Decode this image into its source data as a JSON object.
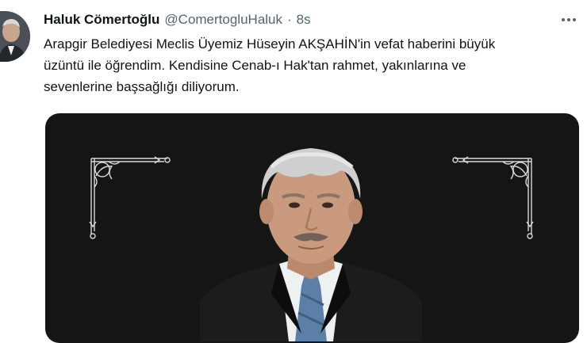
{
  "tweet": {
    "author": {
      "name": "Haluk Cömertoğlu",
      "handle": "@ComertogluHaluk",
      "separator": "·",
      "time": "8s"
    },
    "text_lines": [
      "Arapgir Belediyesi Meclis Üyemiz Hüseyin AKŞAHİN'in vefat haberini büyük",
      "üzüntü ile öğrendim. Kendisine Cenab-ı Hak'tan rahmet, yakınlarına ve",
      "sevenlerine başsağlığı diliyorum."
    ],
    "icons": {
      "more": "more-horizontal-icon"
    },
    "colors": {
      "media_background": "#151515",
      "ornament": "#d9d9d9",
      "secondary_text": "#536471"
    }
  }
}
